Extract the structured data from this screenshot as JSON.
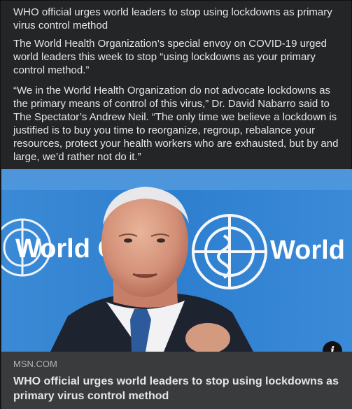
{
  "post": {
    "headline": "WHO official urges world leaders to stop using lockdowns as primary virus control method",
    "paragraph_1": "The World Health Organization’s special envoy on COVID-19 urged world leaders this week to stop “using lockdowns as your primary control method.”",
    "paragraph_2": "“We in the World Health Organization do not advocate lockdowns as the primary means of control of this virus,” Dr. David Nabarro said to The Spectator’s Andrew Neil. “The only time we believe a lockdown is justified is to buy you time to reorganize, regroup, rebalance your resources, protect your health workers who are exhausted, but by and large, we’d rather not do it.”"
  },
  "media": {
    "backdrop_left": "World Organ",
    "backdrop_right": "World H Organiz",
    "info_icon": "info-icon"
  },
  "link": {
    "domain": "MSN.COM",
    "title": "WHO official urges world leaders to stop using lockdowns as primary virus control method"
  },
  "colors": {
    "card_bg": "#242526",
    "preview_bg": "#3a3b3c",
    "text_primary": "#e4e6eb",
    "text_secondary": "#b0b3b8",
    "backdrop_blue": "#2a78c4"
  }
}
